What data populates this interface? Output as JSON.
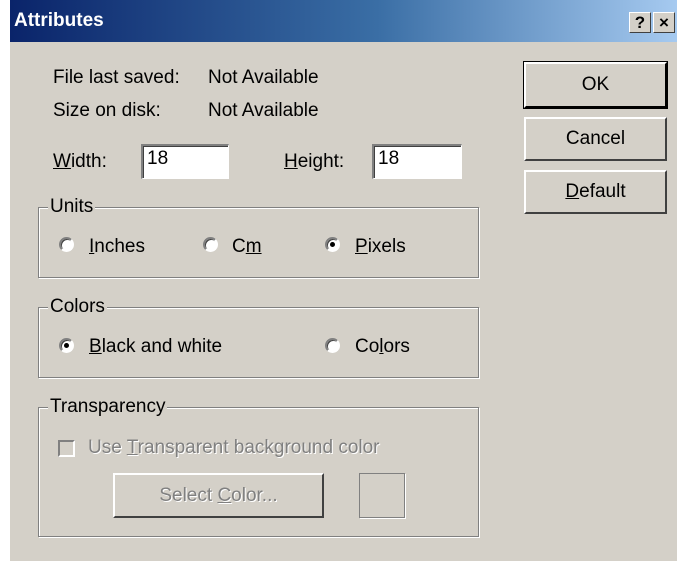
{
  "window": {
    "title": "Attributes",
    "help_btn": "?",
    "close_btn": "×"
  },
  "info": {
    "file_last_saved_label": "File last saved:",
    "file_last_saved_value": "Not Available",
    "size_on_disk_label": "Size on disk:",
    "size_on_disk_value": "Not Available"
  },
  "dimensions": {
    "width_label_key": "W",
    "width_label_rest": "idth:",
    "width_value": "18",
    "height_label_key": "H",
    "height_label_rest": "eight:",
    "height_value": "18"
  },
  "units": {
    "group_label": "Units",
    "inches_key": "I",
    "inches_rest": "nches",
    "cm_pre": "C",
    "cm_key": "m",
    "pixels_key": "P",
    "pixels_rest": "ixels",
    "selected": "Pixels"
  },
  "colors": {
    "group_label": "Colors",
    "bw_key": "B",
    "bw_rest": "lack and white",
    "colors_pre": "Co",
    "colors_key": "l",
    "colors_rest": "ors",
    "selected": "Black and white"
  },
  "transparency": {
    "group_label": "Transparency",
    "checkbox_pre": "Use ",
    "checkbox_key": "T",
    "checkbox_rest": "ransparent background color",
    "checkbox_checked": false,
    "select_pre": "Select ",
    "select_key": "C",
    "select_rest": "olor...",
    "swatch_color": "#d4d0c8"
  },
  "buttons": {
    "ok": "OK",
    "cancel": "Cancel",
    "default_key": "D",
    "default_rest": "efault"
  }
}
